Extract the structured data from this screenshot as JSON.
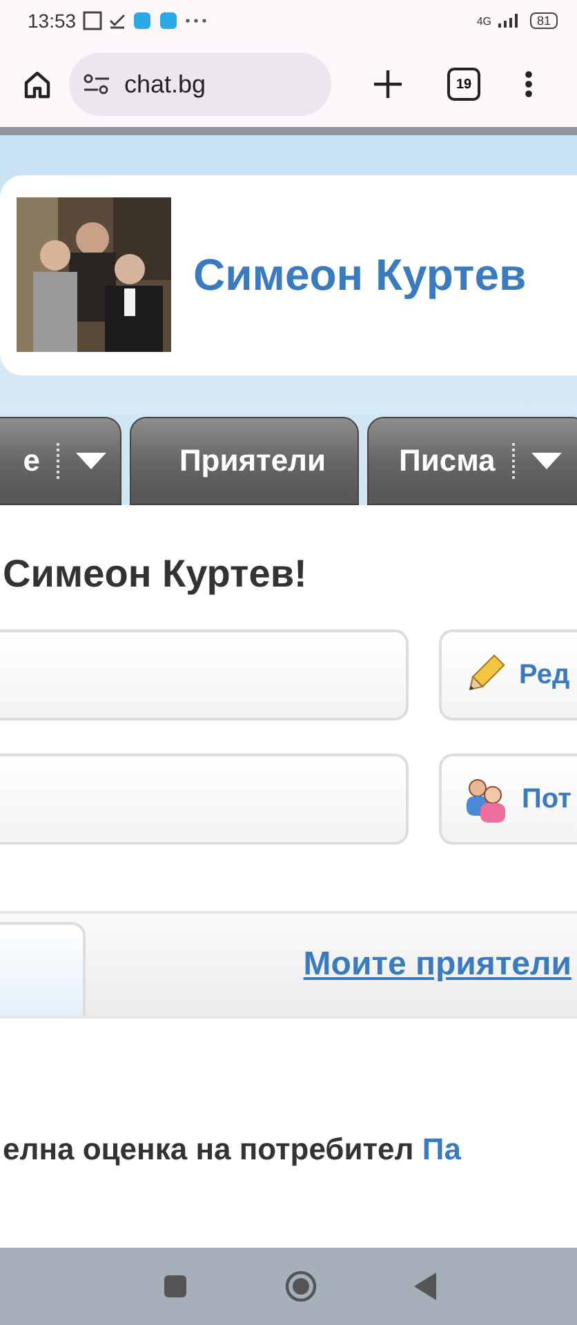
{
  "status_bar": {
    "time": "13:53",
    "network": "4G",
    "battery": "81"
  },
  "browser": {
    "url": "chat.bg",
    "tab_count": "19"
  },
  "profile": {
    "name": "Симеон Куртев"
  },
  "nav_tabs": [
    {
      "label": "е",
      "dropdown": true
    },
    {
      "label": "Приятели",
      "dropdown": false
    },
    {
      "label": "Писма",
      "dropdown": true
    }
  ],
  "greeting": "Симеон Куртев!",
  "action_rows": [
    {
      "kind": "pencil",
      "button": "Ред"
    },
    {
      "kind": "people",
      "button": "Пот"
    }
  ],
  "section_tabs": {
    "link": "Моите приятели"
  },
  "rating": {
    "text": "елна оценка на потребител",
    "link": "Па"
  }
}
